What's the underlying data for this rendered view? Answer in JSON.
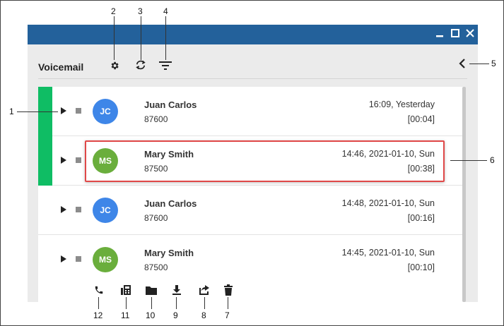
{
  "window": {
    "title_controls": {
      "minimize": "–",
      "maximize": "□",
      "close": "✕"
    },
    "titlebar_color": "#23619b"
  },
  "toolbar": {
    "title": "Voicemail",
    "icons": [
      "settings-gear-icon",
      "refresh-icon",
      "filter-icon"
    ],
    "collapse_icon": "chevron-left-icon"
  },
  "voicemails": [
    {
      "initials": "JC",
      "name": "Juan Carlos",
      "number": "87600",
      "datetime": "16:09, Yesterday",
      "duration": "[00:04]",
      "unread": true,
      "avatar_color": "#3e86e8"
    },
    {
      "initials": "MS",
      "name": "Mary Smith",
      "number": "87500",
      "datetime": "14:46, 2021-01-10, Sun",
      "duration": "[00:38]",
      "unread": true,
      "avatar_color": "#6aae3c"
    },
    {
      "initials": "JC",
      "name": "Juan Carlos",
      "number": "87600",
      "datetime": "14:48, 2021-01-10, Sun",
      "duration": "[00:16]",
      "unread": false,
      "avatar_color": "#3e86e8"
    },
    {
      "initials": "MS",
      "name": "Mary Smith",
      "number": "87500",
      "datetime": "14:45, 2021-01-10, Sun",
      "duration": "[00:10]",
      "unread": false,
      "avatar_color": "#6aae3c"
    }
  ],
  "row_actions": [
    "call-icon",
    "fax-icon",
    "folder-icon",
    "download-icon",
    "share-icon",
    "delete-icon"
  ],
  "callouts": {
    "n1": "1",
    "n2": "2",
    "n3": "3",
    "n4": "4",
    "n5": "5",
    "n6": "6",
    "n7": "7",
    "n8": "8",
    "n9": "9",
    "n10": "10",
    "n11": "11",
    "n12": "12"
  },
  "colors": {
    "unread": "#0fbd64",
    "highlight": "#e04848"
  }
}
